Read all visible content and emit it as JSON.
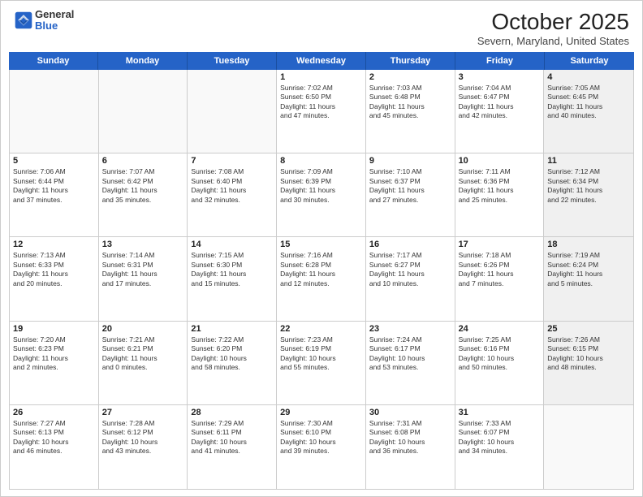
{
  "header": {
    "logo_general": "General",
    "logo_blue": "Blue",
    "month_title": "October 2025",
    "subtitle": "Severn, Maryland, United States"
  },
  "weekdays": [
    "Sunday",
    "Monday",
    "Tuesday",
    "Wednesday",
    "Thursday",
    "Friday",
    "Saturday"
  ],
  "rows": [
    [
      {
        "day": "",
        "info": ""
      },
      {
        "day": "",
        "info": ""
      },
      {
        "day": "",
        "info": ""
      },
      {
        "day": "1",
        "info": "Sunrise: 7:02 AM\nSunset: 6:50 PM\nDaylight: 11 hours\nand 47 minutes."
      },
      {
        "day": "2",
        "info": "Sunrise: 7:03 AM\nSunset: 6:48 PM\nDaylight: 11 hours\nand 45 minutes."
      },
      {
        "day": "3",
        "info": "Sunrise: 7:04 AM\nSunset: 6:47 PM\nDaylight: 11 hours\nand 42 minutes."
      },
      {
        "day": "4",
        "info": "Sunrise: 7:05 AM\nSunset: 6:45 PM\nDaylight: 11 hours\nand 40 minutes."
      }
    ],
    [
      {
        "day": "5",
        "info": "Sunrise: 7:06 AM\nSunset: 6:44 PM\nDaylight: 11 hours\nand 37 minutes."
      },
      {
        "day": "6",
        "info": "Sunrise: 7:07 AM\nSunset: 6:42 PM\nDaylight: 11 hours\nand 35 minutes."
      },
      {
        "day": "7",
        "info": "Sunrise: 7:08 AM\nSunset: 6:40 PM\nDaylight: 11 hours\nand 32 minutes."
      },
      {
        "day": "8",
        "info": "Sunrise: 7:09 AM\nSunset: 6:39 PM\nDaylight: 11 hours\nand 30 minutes."
      },
      {
        "day": "9",
        "info": "Sunrise: 7:10 AM\nSunset: 6:37 PM\nDaylight: 11 hours\nand 27 minutes."
      },
      {
        "day": "10",
        "info": "Sunrise: 7:11 AM\nSunset: 6:36 PM\nDaylight: 11 hours\nand 25 minutes."
      },
      {
        "day": "11",
        "info": "Sunrise: 7:12 AM\nSunset: 6:34 PM\nDaylight: 11 hours\nand 22 minutes."
      }
    ],
    [
      {
        "day": "12",
        "info": "Sunrise: 7:13 AM\nSunset: 6:33 PM\nDaylight: 11 hours\nand 20 minutes."
      },
      {
        "day": "13",
        "info": "Sunrise: 7:14 AM\nSunset: 6:31 PM\nDaylight: 11 hours\nand 17 minutes."
      },
      {
        "day": "14",
        "info": "Sunrise: 7:15 AM\nSunset: 6:30 PM\nDaylight: 11 hours\nand 15 minutes."
      },
      {
        "day": "15",
        "info": "Sunrise: 7:16 AM\nSunset: 6:28 PM\nDaylight: 11 hours\nand 12 minutes."
      },
      {
        "day": "16",
        "info": "Sunrise: 7:17 AM\nSunset: 6:27 PM\nDaylight: 11 hours\nand 10 minutes."
      },
      {
        "day": "17",
        "info": "Sunrise: 7:18 AM\nSunset: 6:26 PM\nDaylight: 11 hours\nand 7 minutes."
      },
      {
        "day": "18",
        "info": "Sunrise: 7:19 AM\nSunset: 6:24 PM\nDaylight: 11 hours\nand 5 minutes."
      }
    ],
    [
      {
        "day": "19",
        "info": "Sunrise: 7:20 AM\nSunset: 6:23 PM\nDaylight: 11 hours\nand 2 minutes."
      },
      {
        "day": "20",
        "info": "Sunrise: 7:21 AM\nSunset: 6:21 PM\nDaylight: 11 hours\nand 0 minutes."
      },
      {
        "day": "21",
        "info": "Sunrise: 7:22 AM\nSunset: 6:20 PM\nDaylight: 10 hours\nand 58 minutes."
      },
      {
        "day": "22",
        "info": "Sunrise: 7:23 AM\nSunset: 6:19 PM\nDaylight: 10 hours\nand 55 minutes."
      },
      {
        "day": "23",
        "info": "Sunrise: 7:24 AM\nSunset: 6:17 PM\nDaylight: 10 hours\nand 53 minutes."
      },
      {
        "day": "24",
        "info": "Sunrise: 7:25 AM\nSunset: 6:16 PM\nDaylight: 10 hours\nand 50 minutes."
      },
      {
        "day": "25",
        "info": "Sunrise: 7:26 AM\nSunset: 6:15 PM\nDaylight: 10 hours\nand 48 minutes."
      }
    ],
    [
      {
        "day": "26",
        "info": "Sunrise: 7:27 AM\nSunset: 6:13 PM\nDaylight: 10 hours\nand 46 minutes."
      },
      {
        "day": "27",
        "info": "Sunrise: 7:28 AM\nSunset: 6:12 PM\nDaylight: 10 hours\nand 43 minutes."
      },
      {
        "day": "28",
        "info": "Sunrise: 7:29 AM\nSunset: 6:11 PM\nDaylight: 10 hours\nand 41 minutes."
      },
      {
        "day": "29",
        "info": "Sunrise: 7:30 AM\nSunset: 6:10 PM\nDaylight: 10 hours\nand 39 minutes."
      },
      {
        "day": "30",
        "info": "Sunrise: 7:31 AM\nSunset: 6:08 PM\nDaylight: 10 hours\nand 36 minutes."
      },
      {
        "day": "31",
        "info": "Sunrise: 7:33 AM\nSunset: 6:07 PM\nDaylight: 10 hours\nand 34 minutes."
      },
      {
        "day": "",
        "info": ""
      }
    ]
  ]
}
